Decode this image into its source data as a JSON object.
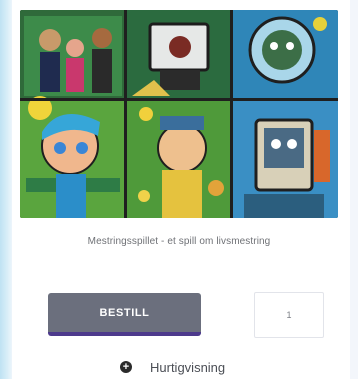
{
  "product": {
    "image_alt": "Mestringsspillet artwork illustration",
    "name": "Mestringsspillet - et spill om livsmestring"
  },
  "actions": {
    "order_label": "BESTILL",
    "quantity_value": "1",
    "quickview_label": "Hurtigvisning",
    "quickview_icon": "plus-circle-icon"
  },
  "colors": {
    "button_bg": "#6b6f7d",
    "button_underline": "#4d3a8c",
    "background": "#f3f6fb"
  }
}
